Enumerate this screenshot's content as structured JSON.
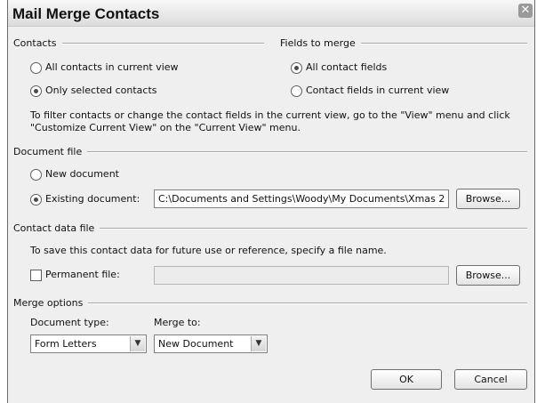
{
  "dialog": {
    "title": "Mail Merge Contacts",
    "close_glyph": "✕"
  },
  "contacts": {
    "label": "Contacts",
    "options": [
      "All contacts in current view",
      "Only selected contacts"
    ],
    "selected": "Only selected contacts"
  },
  "fields": {
    "label": "Fields to merge",
    "options": [
      "All contact fields",
      "Contact fields in current view"
    ],
    "selected": "All contact fields"
  },
  "filter_note": {
    "line1": "To filter contacts or change the contact fields in the current view, go to the \"View\" menu and click",
    "line2": "\"Customize Current View\" on the \"Current View\" menu."
  },
  "document_file": {
    "label": "Document file",
    "new_label": "New document",
    "existing_label": "Existing document:",
    "selected": "Existing document",
    "path": "C:\\Documents and Settings\\Woody\\My Documents\\Xmas 2",
    "browse_label": "Browse..."
  },
  "contact_data_file": {
    "label": "Contact data file",
    "description": "To save this contact data for future use or reference, specify a file name.",
    "permanent_label": "Permanent file:",
    "permanent_checked": false,
    "path": "",
    "browse_label": "Browse..."
  },
  "merge_options": {
    "label": "Merge options",
    "doc_type_label": "Document type:",
    "doc_type_value": "Form Letters",
    "merge_to_label": "Merge to:",
    "merge_to_value": "New Document"
  },
  "buttons": {
    "ok": "OK",
    "cancel": "Cancel"
  },
  "icons": {
    "dropdown_arrow": "▼"
  }
}
